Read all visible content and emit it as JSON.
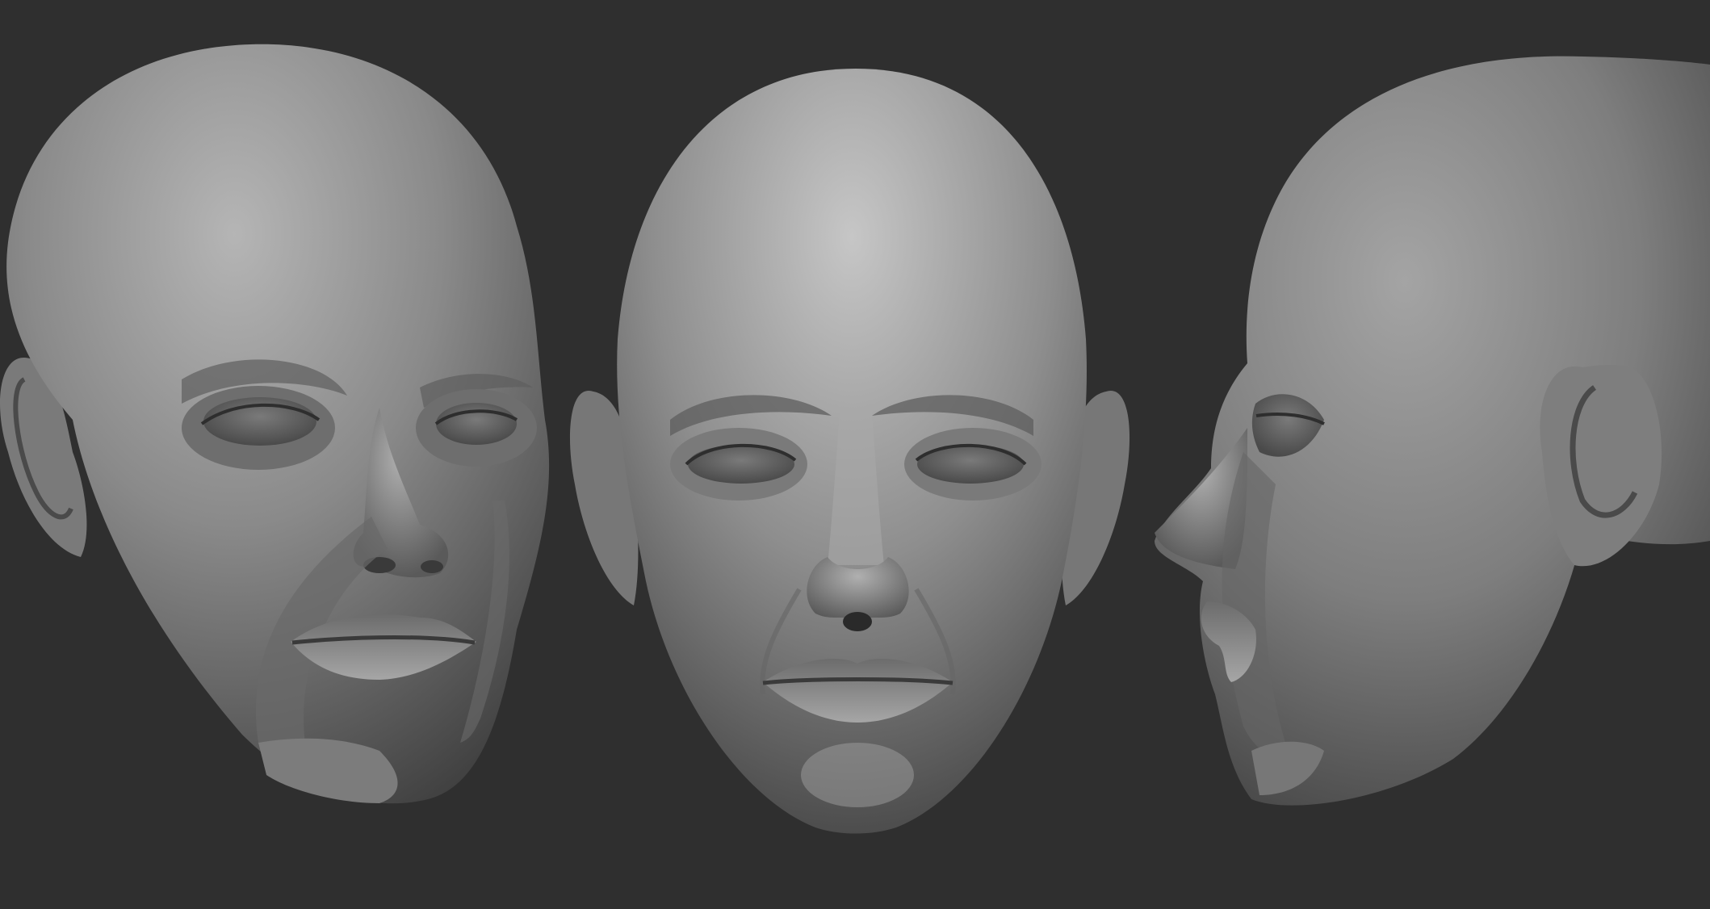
{
  "scene": {
    "background_color": "#2f2f2f",
    "clay_color": "#8c8c8c",
    "highlight_color": "#c4c4c4",
    "shadow_color": "#3a3a3a",
    "views": [
      {
        "name": "three-quarter",
        "icon": "head-three-quarter-view"
      },
      {
        "name": "front",
        "icon": "head-front-view"
      },
      {
        "name": "profile",
        "icon": "head-side-view"
      }
    ]
  }
}
